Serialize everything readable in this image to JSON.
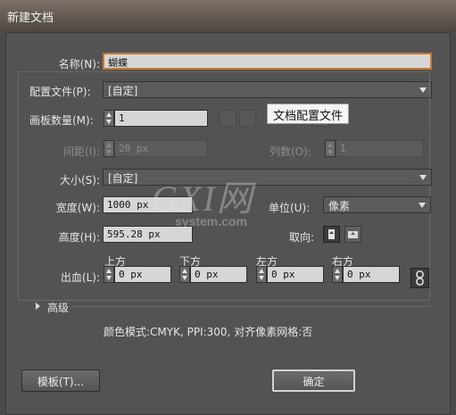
{
  "window": {
    "title": "新建文档"
  },
  "name": {
    "label": "名称(N):",
    "value": "蝴蝶"
  },
  "profile": {
    "label": "配置文件(P):",
    "value": "[自定]"
  },
  "tooltip": "文档配置文件",
  "artboards": {
    "label": "画板数量(M):",
    "value": "1"
  },
  "spacing": {
    "label": "间距(I):",
    "value": "20 px"
  },
  "columns": {
    "label": "列数(O):",
    "value": "1"
  },
  "size": {
    "label": "大小(S):",
    "value": "[自定]"
  },
  "width": {
    "label": "宽度(W):",
    "value": "1000 px"
  },
  "units": {
    "label": "单位(U):",
    "value": "像素"
  },
  "height": {
    "label": "高度(H):",
    "value": "595.28 px"
  },
  "orientation": {
    "label": "取向:"
  },
  "bleed": {
    "label": "出血(L):",
    "top": {
      "label": "上方",
      "value": "0 px"
    },
    "bottom": {
      "label": "下方",
      "value": "0 px"
    },
    "left": {
      "label": "左方",
      "value": "0 px"
    },
    "right": {
      "label": "右方",
      "value": "0 px"
    }
  },
  "advanced": {
    "label": "高级"
  },
  "summary": "颜色模式:CMYK, PPI:300, 对齐像素网格:否",
  "buttons": {
    "templates": "模板(T)...",
    "ok": "确定"
  },
  "watermark": {
    "logo": "GXI网",
    "domain": "system.com"
  },
  "icons": [
    "arrange-grid-by-row-icon",
    "arrange-grid-by-column-icon",
    "portrait-icon",
    "landscape-icon",
    "link-bleed-icon"
  ]
}
